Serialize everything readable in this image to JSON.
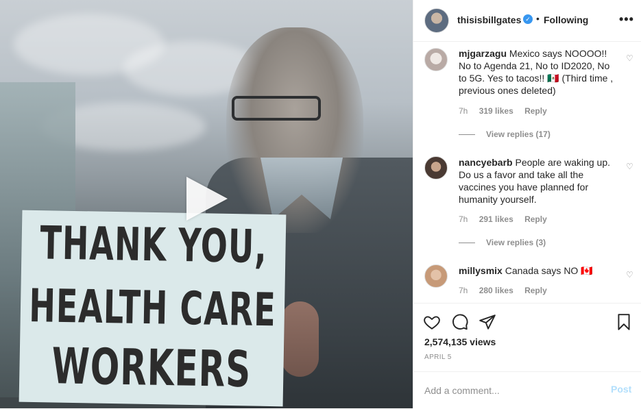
{
  "post": {
    "username": "thisisbillgates",
    "separator": "•",
    "follow_state": "Following",
    "more_label": "•••",
    "verified_mark": "✓"
  },
  "media": {
    "sign_lines": [
      "THANK YOU,",
      "HEALTH CARE",
      "WORKERS"
    ],
    "play_icon": "play-icon"
  },
  "comments": [
    {
      "user": "mjgarzagu",
      "text": "Mexico says NOOOO!! No to Agenda 21, No to ID2020, No to 5G. Yes to tacos!! 🇲🇽 (Third time , previous ones deleted)",
      "age": "7h",
      "likes": "319 likes",
      "reply": "Reply",
      "view_replies": "View replies (17)"
    },
    {
      "user": "nancyebarb",
      "text": "People are waking up. Do us a favor and take all the vaccines you have planned for humanity yourself.",
      "age": "7h",
      "likes": "291 likes",
      "reply": "Reply",
      "view_replies": "View replies (3)"
    },
    {
      "user": "millysmix",
      "text": "Canada says NO 🇨🇦",
      "age": "7h",
      "likes": "280 likes",
      "reply": "Reply"
    }
  ],
  "stats": {
    "views": "2,574,135 views",
    "date": "APRIL 5"
  },
  "composer": {
    "placeholder": "Add a comment...",
    "post_label": "Post"
  },
  "colors": {
    "accent": "#3897f0",
    "post_disabled": "#b2dffc",
    "muted": "#8e8e8e"
  }
}
